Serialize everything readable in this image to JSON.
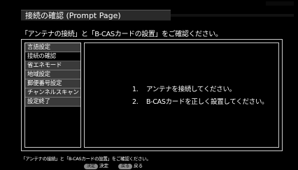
{
  "header": {
    "title": "接続の確認 (Prompt Page)"
  },
  "instruction": "「アンテナの接続」と「B-CASカードの設置」をご確認ください。",
  "menu": {
    "items": [
      {
        "label": "言語設定",
        "active": false
      },
      {
        "label": "接続の確認",
        "active": true
      },
      {
        "label": "省エネモード",
        "active": false
      },
      {
        "label": "地域設定",
        "active": false
      },
      {
        "label": "郵便番号設定",
        "active": false
      },
      {
        "label": "チャンネルスキャン",
        "active": false
      },
      {
        "label": "設定終了",
        "active": false
      }
    ]
  },
  "content": {
    "line1_num": "1.",
    "line1_text": "アンテナを接続してください。",
    "line2_num": "2.",
    "line2_text": "B-CASカードを正しく設置してください。"
  },
  "footer": {
    "text": "「アンテナの接続」と「B-CASカードの設置」をご確認ください。",
    "keys": [
      {
        "key": "決定",
        "label": "決定"
      },
      {
        "key": "戻る",
        "label": "戻る"
      }
    ]
  }
}
